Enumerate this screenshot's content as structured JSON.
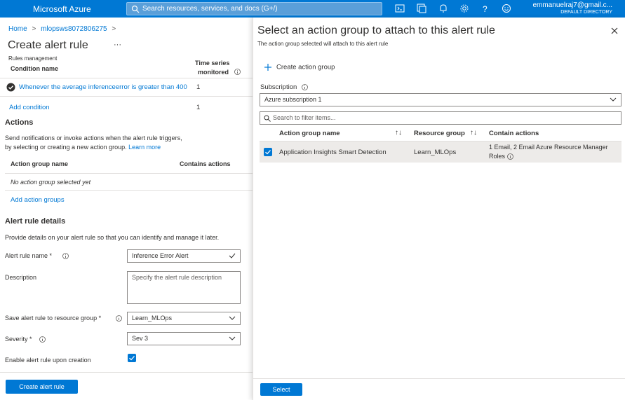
{
  "topbar": {
    "brand": "Microsoft Azure",
    "search_placeholder": "Search resources, services, and docs (G+/)",
    "user_email": "emmanuelraj7@gmail.c...",
    "user_directory": "DEFAULT DIRECTORY",
    "icons": [
      "cloud-shell-icon",
      "directory-filter-icon",
      "notifications-icon",
      "settings-icon",
      "help-icon",
      "feedback-icon"
    ]
  },
  "breadcrumb": {
    "home": "Home",
    "resource": "mlopsws8072806275",
    "sep": ">"
  },
  "left": {
    "title": "Create alert rule",
    "more": "···",
    "subtitle": "Rules management",
    "conditions": {
      "col_name": "Condition name",
      "col_series_1": "Time series",
      "col_series_2": "monitored",
      "row_text": "Whenever the average inferenceerror is greater than 400",
      "row_count": "1",
      "add_label": "Add condition",
      "add_count": "1"
    },
    "actions": {
      "heading": "Actions",
      "desc_1": "Send notifications or invoke actions when the alert rule triggers,",
      "desc_2": "by selecting or creating a new action group.",
      "learn_more": "Learn more",
      "col_group": "Action group name",
      "col_contains": "Contains actions",
      "empty": "No action group selected yet",
      "add_label": "Add action groups"
    },
    "details": {
      "heading": "Alert rule details",
      "desc": "Provide details on your alert rule so that you can identify and manage it later.",
      "name_label": "Alert rule name *",
      "name_value": "Inference Error Alert",
      "desc_label": "Description",
      "desc_placeholder": "Specify the alert rule description",
      "rg_label": "Save alert rule to resource group *",
      "rg_value": "Learn_MLOps",
      "sev_label": "Severity *",
      "sev_value": "Sev 3",
      "enable_label": "Enable alert rule upon creation"
    },
    "create_button": "Create alert rule"
  },
  "panel": {
    "title": "Select an action group to attach to this alert rule",
    "subtitle": "The action group selected will attach to this alert rule",
    "create_label": "Create action group",
    "sub_label": "Subscription",
    "sub_value": "Azure subscription 1",
    "filter_placeholder": "Search to filter items...",
    "columns": [
      "Action group name",
      "Resource group",
      "Contain actions"
    ],
    "sort_glyph": "↑↓",
    "rows": [
      {
        "name": "Application Insights Smart Detection",
        "resource_group": "Learn_MLOps",
        "actions_1": "1 Email, 2 Email Azure Resource Manager",
        "actions_2": "Roles"
      }
    ],
    "select_button": "Select"
  },
  "colors": {
    "accent": "#0078d4",
    "selected_row": "#edebe9",
    "success": "#323130"
  }
}
